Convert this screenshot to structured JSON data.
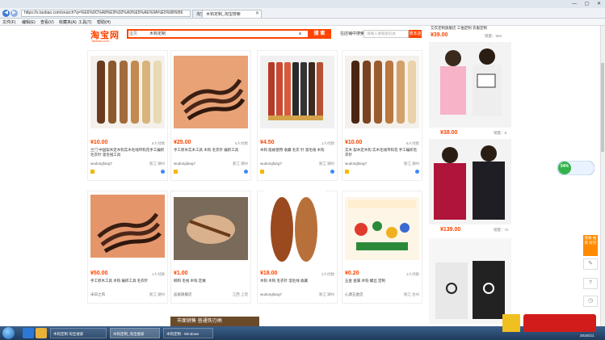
{
  "browser": {
    "url": "https://s.taobao.com/search?q=%E6%9C%A8%E9%92%A9%E5%AE%9A%E5%88%B6",
    "tabs": [
      {
        "label": "淘宝网"
      },
      {
        "label": "木钩定制_淘宝搜索"
      }
    ],
    "menu": [
      "文件(F)",
      "编辑(E)",
      "查看(V)",
      "收藏夹(A)",
      "工具(T)",
      "帮助(H)"
    ]
  },
  "header": {
    "logo": "淘宝网",
    "logo_sub": "Taobao.com",
    "search_category": "宝贝",
    "search_value": "木钩定制",
    "search_button": "搜 索",
    "shop_label": "在店铺中搜索",
    "shop_placeholder": "请输入要搜索的关",
    "shop_button": "搜本店"
  },
  "products": [
    {
      "price": "¥10.00",
      "buyers": "8人付款",
      "title": "兰门 中国梨木定木钩实木毛线带钩花手工编织毛衣针 溜毛线工具",
      "seller": "wudongfang7",
      "loc": "浙江 湖州"
    },
    {
      "price": "¥25.00",
      "buyers": "5人付款",
      "title": "手工原木实木工具 木钩 毛衣针 编织工具",
      "seller": "wudongfang7",
      "loc": "浙江 湖州"
    },
    {
      "price": "¥4.50",
      "buyers": "1人付款",
      "title": "木钩 能被使用 收藏 毛衣 针 溜毛线 木钩",
      "seller": "wudongfang7",
      "loc": "浙江 湖州"
    },
    {
      "price": "¥10.00",
      "buyers": "8人付款",
      "title": "实木 梨木定木钩 实木毛线带钩花 手工编织毛衣针",
      "seller": "wudongfang7",
      "loc": "浙江 湖州"
    },
    {
      "price": "¥50.00",
      "buyers": "1人付款",
      "title": "手工原木工具 木钩 编织工具 毛衣针",
      "seller": "米日之风",
      "loc": "浙江 湖州"
    },
    {
      "price": "¥1.00",
      "buyers": "",
      "title": "颐和 毛线 木钩 定做",
      "seller": "品质旗舰店",
      "loc": "江西 上饶"
    },
    {
      "price": "¥18.00",
      "buyers": "2人付款",
      "title": "木钩 木钩 毛衣针 溜毛线 收藏",
      "seller": "wudongfang7",
      "loc": "浙江 湖州"
    },
    {
      "price": "¥0.20",
      "buyers": "1人付款",
      "title": "五金 金属 木钩 螺丝 定制",
      "seller": "心源五金店",
      "loc": "浙江 台州"
    }
  ],
  "right_ads": {
    "top_text": "艾衣定制旗舰店 工恤定制 衣服定制",
    "top_price": "¥39.00",
    "top_sold": "销量：583",
    "price1": "¥38.00",
    "sold1": "销量：8",
    "price2": "¥139.00",
    "sold2": "销量：72"
  },
  "side_tools": {
    "orange": "我要 推荐 好货"
  },
  "taskbar": {
    "tasks": [
      "木钩定制 淘宝搜索",
      "木钩定制_淘宝搜索",
      "木钩定制 - Windows"
    ],
    "date": "2016/1/1"
  },
  "banner_text": "市面销售  普通铁刃柄",
  "speed": "54%",
  "colors": {
    "accent": "#ff4400",
    "taskbar": "#2a4a70"
  }
}
